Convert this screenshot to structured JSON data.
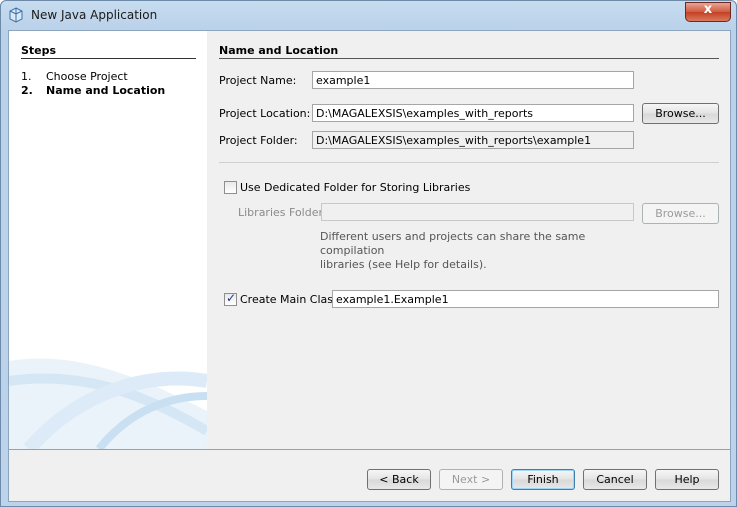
{
  "window": {
    "title": "New Java Application",
    "close_glyph": "x"
  },
  "steps": {
    "title": "Steps",
    "items": [
      {
        "num": "1.",
        "label": "Choose Project"
      },
      {
        "num": "2.",
        "label": "Name and Location"
      }
    ]
  },
  "section": {
    "title": "Name and Location"
  },
  "project_name": {
    "label": "Project Name:",
    "value": "example1"
  },
  "project_location": {
    "label": "Project Location:",
    "value": "D:\\MAGALEXSIS\\examples_with_reports",
    "browse": "Browse..."
  },
  "project_folder": {
    "label": "Project Folder:",
    "value": "D:\\MAGALEXSIS\\examples_with_reports\\example1"
  },
  "libraries": {
    "checkbox_label": "Use Dedicated Folder for Storing Libraries",
    "checked": false,
    "folder_label": "Libraries Folder:",
    "folder_value": "",
    "browse": "Browse...",
    "help_line1": "Different users and projects can share the same compilation",
    "help_line2": "libraries (see Help for details)."
  },
  "main_class": {
    "checkbox_label": "Create Main Class",
    "checked": true,
    "value": "example1.Example1"
  },
  "buttons": {
    "back": "< Back",
    "next": "Next >",
    "finish": "Finish",
    "cancel": "Cancel",
    "help": "Help"
  },
  "icons": {
    "app": "java-cup-icon",
    "check": "✓"
  }
}
